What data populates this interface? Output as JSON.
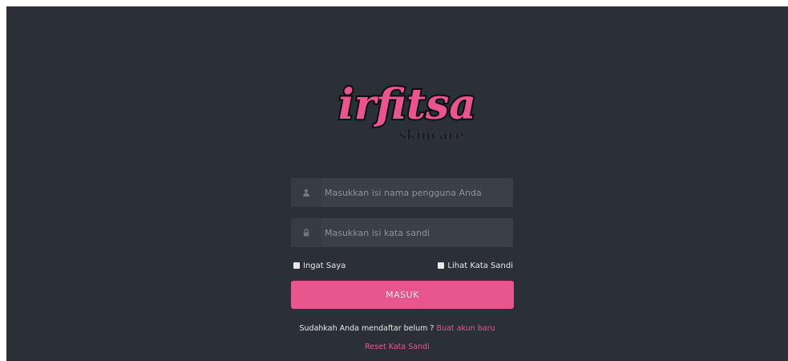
{
  "brand": {
    "name": "irfitsa",
    "tagline": "skincare",
    "colors": {
      "accent": "#e9568e",
      "background": "#2b3037",
      "field": "#3a4048"
    }
  },
  "form": {
    "username": {
      "placeholder": "Masukkan isi nama pengguna Anda",
      "value": "",
      "icon": "user-icon"
    },
    "password": {
      "placeholder": "Masukkan isi kata sandi",
      "value": "",
      "icon": "lock-icon"
    },
    "remember_label": "Ingat Saya",
    "show_password_label": "Lihat Kata Sandi",
    "submit_label": "MASUK"
  },
  "footer": {
    "signup_prompt": "Sudahkah Anda mendaftar belum ?",
    "signup_link": "Buat akun baru",
    "reset_link": "Reset Kata Sandi"
  }
}
